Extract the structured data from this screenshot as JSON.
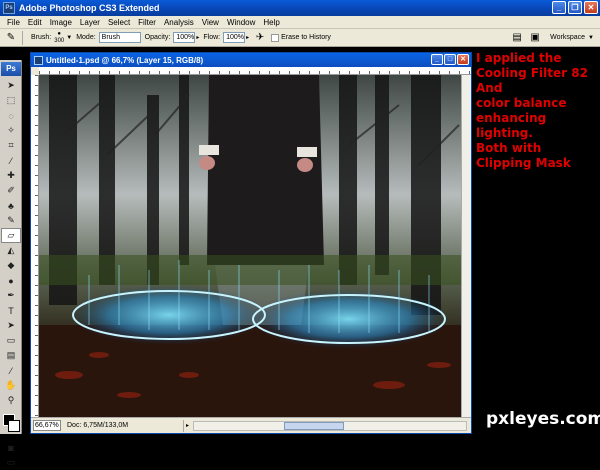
{
  "app": {
    "title": "Adobe Photoshop CS3 Extended",
    "logo": "Ps"
  },
  "menu": [
    "File",
    "Edit",
    "Image",
    "Layer",
    "Select",
    "Filter",
    "Analysis",
    "View",
    "Window",
    "Help"
  ],
  "options": {
    "brush_label": "Brush:",
    "brush_size": "300",
    "mode_label": "Mode:",
    "mode_value": "Brush",
    "opacity_label": "Opacity:",
    "opacity_value": "100%",
    "flow_label": "Flow:",
    "flow_value": "100%",
    "erase_history": "Erase to History",
    "workspace_label": "Workspace"
  },
  "document": {
    "title": "Untitled-1.psd @ 66,7% (Layer 15, RGB/8)",
    "zoom": "66,67%",
    "doc_size": "Doc: 6,75M/133,0M"
  },
  "annotation": {
    "lines": [
      "I applied the",
      "Cooling Filter 82",
      "And",
      "color balance",
      "enhancing",
      "lighting.",
      "Both with",
      "Clipping Mask"
    ]
  },
  "watermark": "pxleyes.com"
}
